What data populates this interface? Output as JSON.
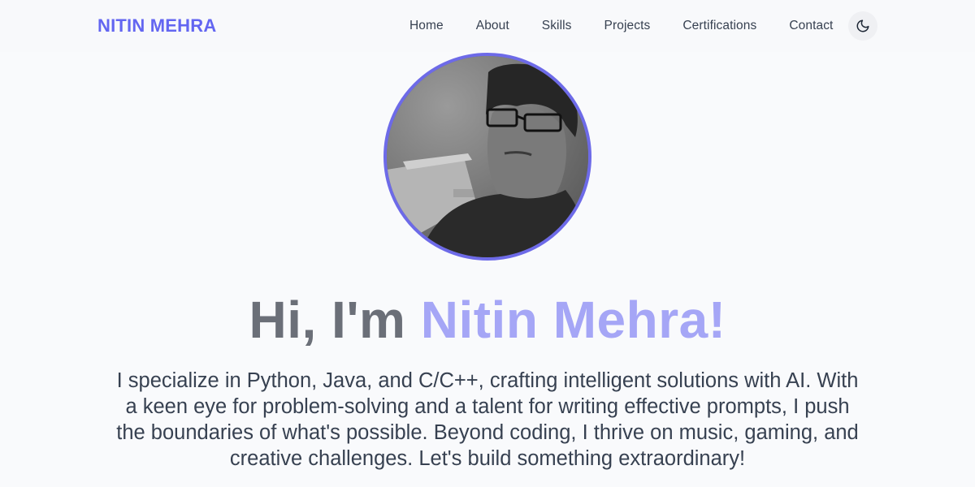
{
  "header": {
    "brand": "NITIN MEHRA",
    "nav": [
      "Home",
      "About",
      "Skills",
      "Projects",
      "Certifications",
      "Contact"
    ],
    "theme_toggle_icon": "moon-icon"
  },
  "hero": {
    "avatar_icon": "profile-photo",
    "greeting": "Hi, I'm",
    "name": "Nitin Mehra!",
    "description": "I specialize in Python, Java, and C/C++, crafting intelligent solutions with AI. With a keen eye for problem-solving and a talent for writing effective prompts, I push the boundaries of what's possible. Beyond coding, I thrive on music, gaming, and creative challenges. Let's build something extraordinary!"
  },
  "colors": {
    "accent": "#6366f1",
    "name_highlight": "#a5a6f6",
    "title_gray": "#6b6f78",
    "avatar_border": "#6d6ae8"
  }
}
